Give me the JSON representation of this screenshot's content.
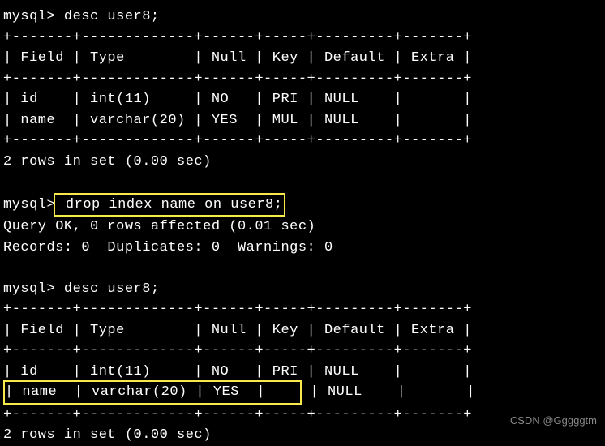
{
  "terminal": {
    "prompt": "mysql>",
    "cmd1": " desc user8;",
    "sep_top1": "+-------+-------------+------+-----+---------+-------+",
    "hdr1": "| Field | Type        | Null | Key | Default | Extra |",
    "sep_mid1": "+-------+-------------+------+-----+---------+-------+",
    "row1a": "| id    | int(11)     | NO   | PRI | NULL    |       |",
    "row1b": "| name  | varchar(20) | YES  | MUL | NULL    |       |",
    "sep_bot1": "+-------+-------------+------+-----+---------+-------+",
    "result1": "2 rows in set (0.00 sec)",
    "blank": " ",
    "cmd2_hl": " drop index name on user8;",
    "qok": "Query OK, 0 rows affected (0.01 sec)",
    "recs": "Records: 0  Duplicates: 0  Warnings: 0",
    "cmd3": " desc user8;",
    "sep_top2": "+-------+-------------+------+-----+---------+-------+",
    "hdr2": "| Field | Type        | Null | Key | Default | Extra |",
    "sep_mid2": "+-------+-------------+------+-----+---------+-------+",
    "row2a": "| id    | int(11)     | NO   | PRI | NULL    |       |",
    "row2b_hl": "| name  | varchar(20) | YES  |    ",
    "row2b_rest": " | NULL    |       |",
    "sep_bot2": "+-------+-------------+------+-----+---------+-------+",
    "result2": "2 rows in set (0.00 sec)"
  },
  "watermark": "CSDN @Gggggtm"
}
